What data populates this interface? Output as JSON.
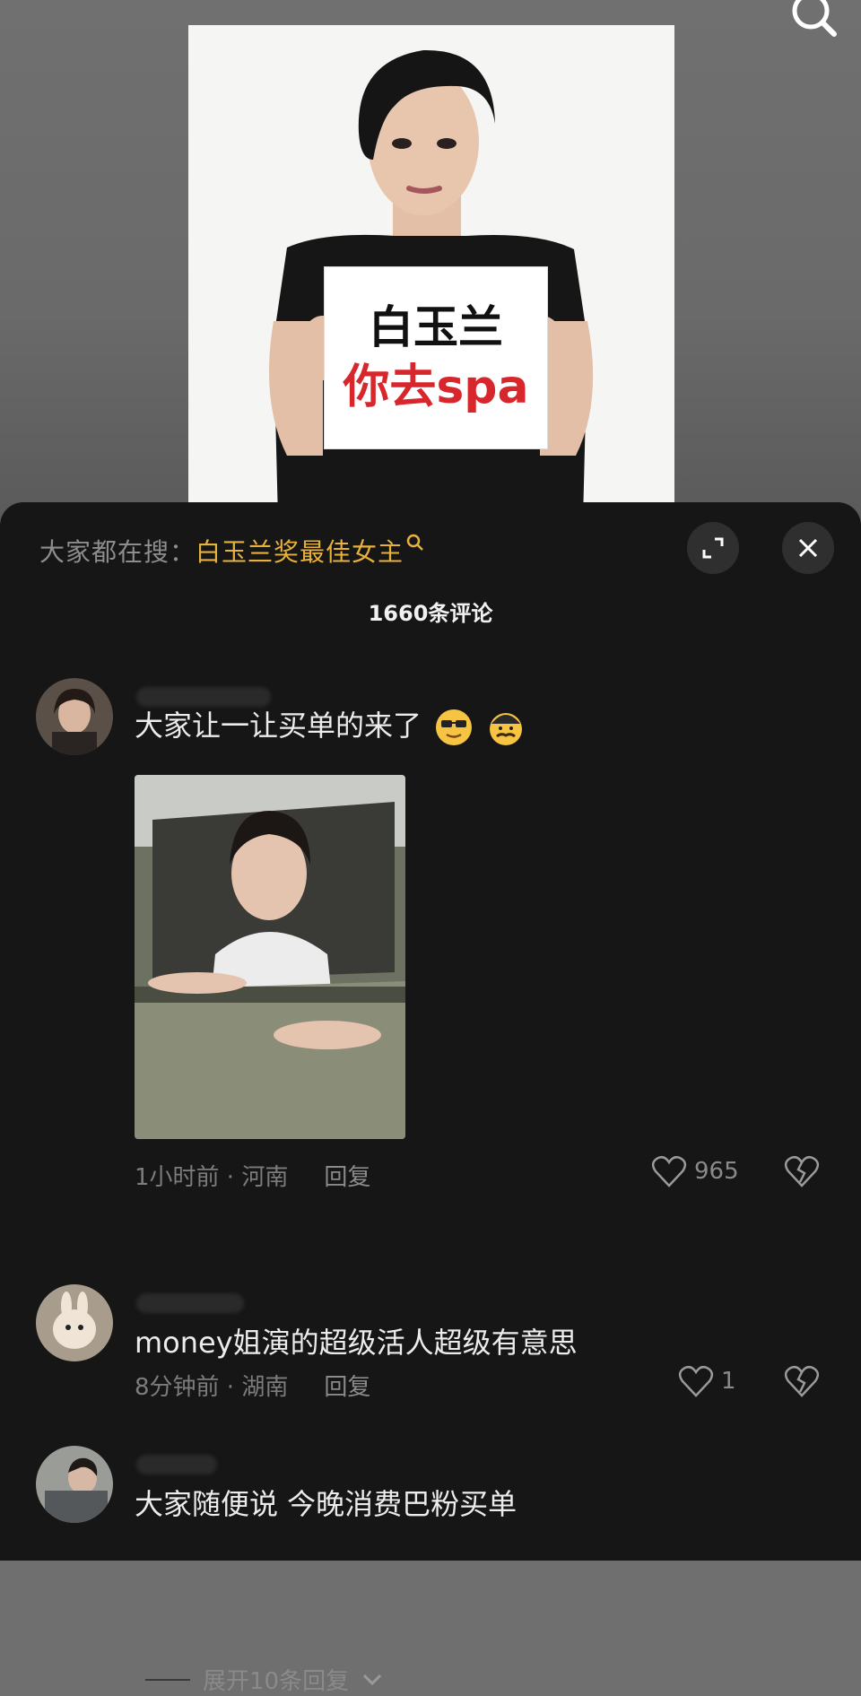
{
  "poster": {
    "line1": "白玉兰",
    "line2": "你去spa"
  },
  "panel": {
    "trend_prefix": "大家都在搜：",
    "trend_link": "白玉兰奖最佳女主",
    "comment_count": "1660条评论"
  },
  "comments": [
    {
      "text": "大家让一让买单的来了",
      "emojis": [
        "sunglasses-emoji",
        "mustache-face-emoji"
      ],
      "meta": "1小时前 · 河南",
      "reply": "回复",
      "likes": "965",
      "expand_replies": "展开10条回复"
    },
    {
      "text": "money姐演的超级活人超级有意思",
      "meta": "8分钟前 · 湖南",
      "reply": "回复",
      "likes": "1"
    },
    {
      "text": "大家随便说 今晚消费巴粉买单"
    }
  ],
  "colors": {
    "panel_bg": "#161616",
    "trend_link": "#e6b13d",
    "sign_red": "#d8262d"
  }
}
